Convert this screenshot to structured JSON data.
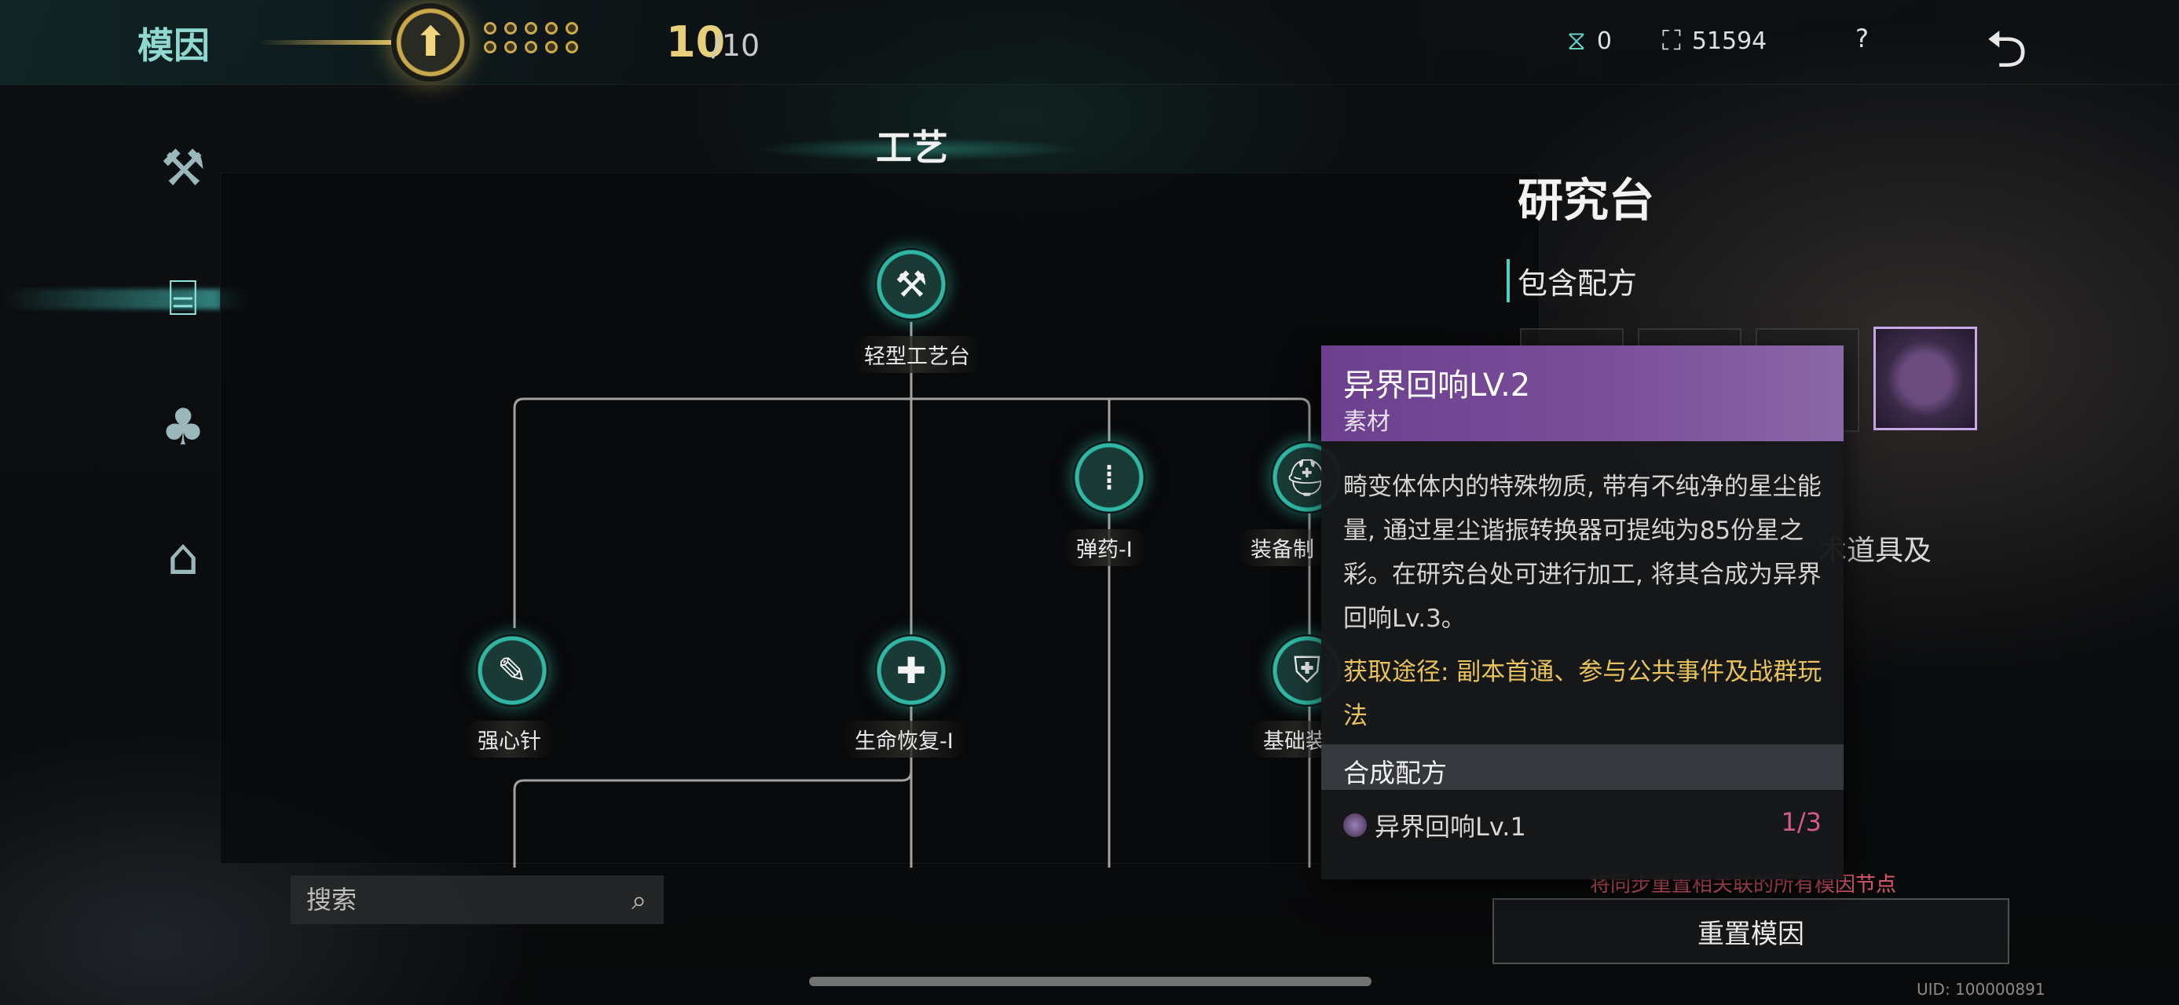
{
  "header": {
    "title": "模因",
    "level_current": "10",
    "level_max": "/10",
    "currency_a": {
      "icon": "hourglass-icon",
      "value": "0"
    },
    "currency_b": {
      "icon": "gem-icon",
      "value": "51594"
    },
    "help_label": "?",
    "back_icon": "back-arrow-icon"
  },
  "nav": [
    {
      "icon": "axe-icon",
      "active": false
    },
    {
      "icon": "workbench-icon",
      "active": true
    },
    {
      "icon": "tree-icon",
      "active": false
    },
    {
      "icon": "house-icon",
      "active": false
    }
  ],
  "tree": {
    "title": "工艺",
    "nodes": {
      "light_bench": "轻型工艺台",
      "ammo": "弹药-I",
      "equip": "装备制",
      "stimulant": "强心针",
      "life": "生命恢复-I",
      "basic": "基础装"
    }
  },
  "search": {
    "placeholder": "搜索"
  },
  "panel": {
    "title": "研究台",
    "recipes_heading": "包含配方",
    "desc_peek": "术道具及",
    "warning": "将同步重置相关联的所有模因节点",
    "reset_button": "重置模因",
    "uid": "UID: 100000891"
  },
  "tooltip": {
    "name": "异界回响LV.2",
    "type": "素材",
    "description": "畸变体体内的特殊物质, 带有不纯净的星尘能量, 通过星尘谐振转换器可提纯为85份星之彩。在研究台处可进行加工, 将其合成为异界回响Lv.3。",
    "source": "获取途径: 副本首通、参与公共事件及战群玩法",
    "recipe_title": "合成配方",
    "recipe_item": "异界回响Lv.1",
    "recipe_count": "1/3"
  }
}
